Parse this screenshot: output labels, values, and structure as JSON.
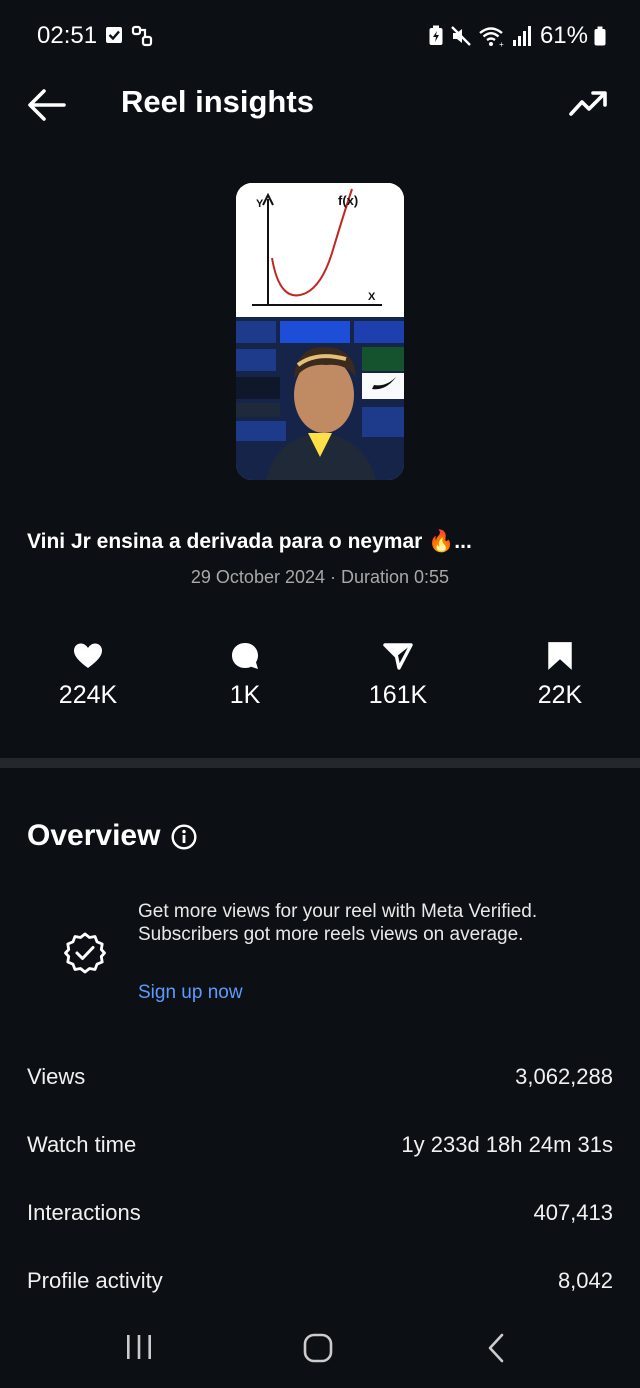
{
  "status_bar": {
    "time": "02:51",
    "battery": "61%"
  },
  "header": {
    "title": "Reel insights"
  },
  "reel": {
    "caption": "Vini Jr ensina a derivada para o neymar 🔥...",
    "date_duration": "29 October 2024 · Duration 0:55",
    "thumbnail": {
      "graph_y_label": "Y",
      "graph_x_label": "X",
      "graph_fx_label": "f(x)"
    }
  },
  "stats": {
    "likes": "224K",
    "comments": "1K",
    "shares": "161K",
    "saves": "22K"
  },
  "overview": {
    "title": "Overview",
    "promo_text": "Get more views for your reel with Meta Verified. Subscribers got more reels views on average.",
    "promo_link": "Sign up now",
    "metrics": [
      {
        "label": "Views",
        "value": "3,062,288"
      },
      {
        "label": "Watch time",
        "value": "1y 233d 18h 24m 31s"
      },
      {
        "label": "Interactions",
        "value": "407,413"
      },
      {
        "label": "Profile activity",
        "value": "8,042"
      }
    ]
  },
  "colors": {
    "background": "#0c1014",
    "link": "#5b9bff",
    "muted_text": "#a8a8a8"
  }
}
